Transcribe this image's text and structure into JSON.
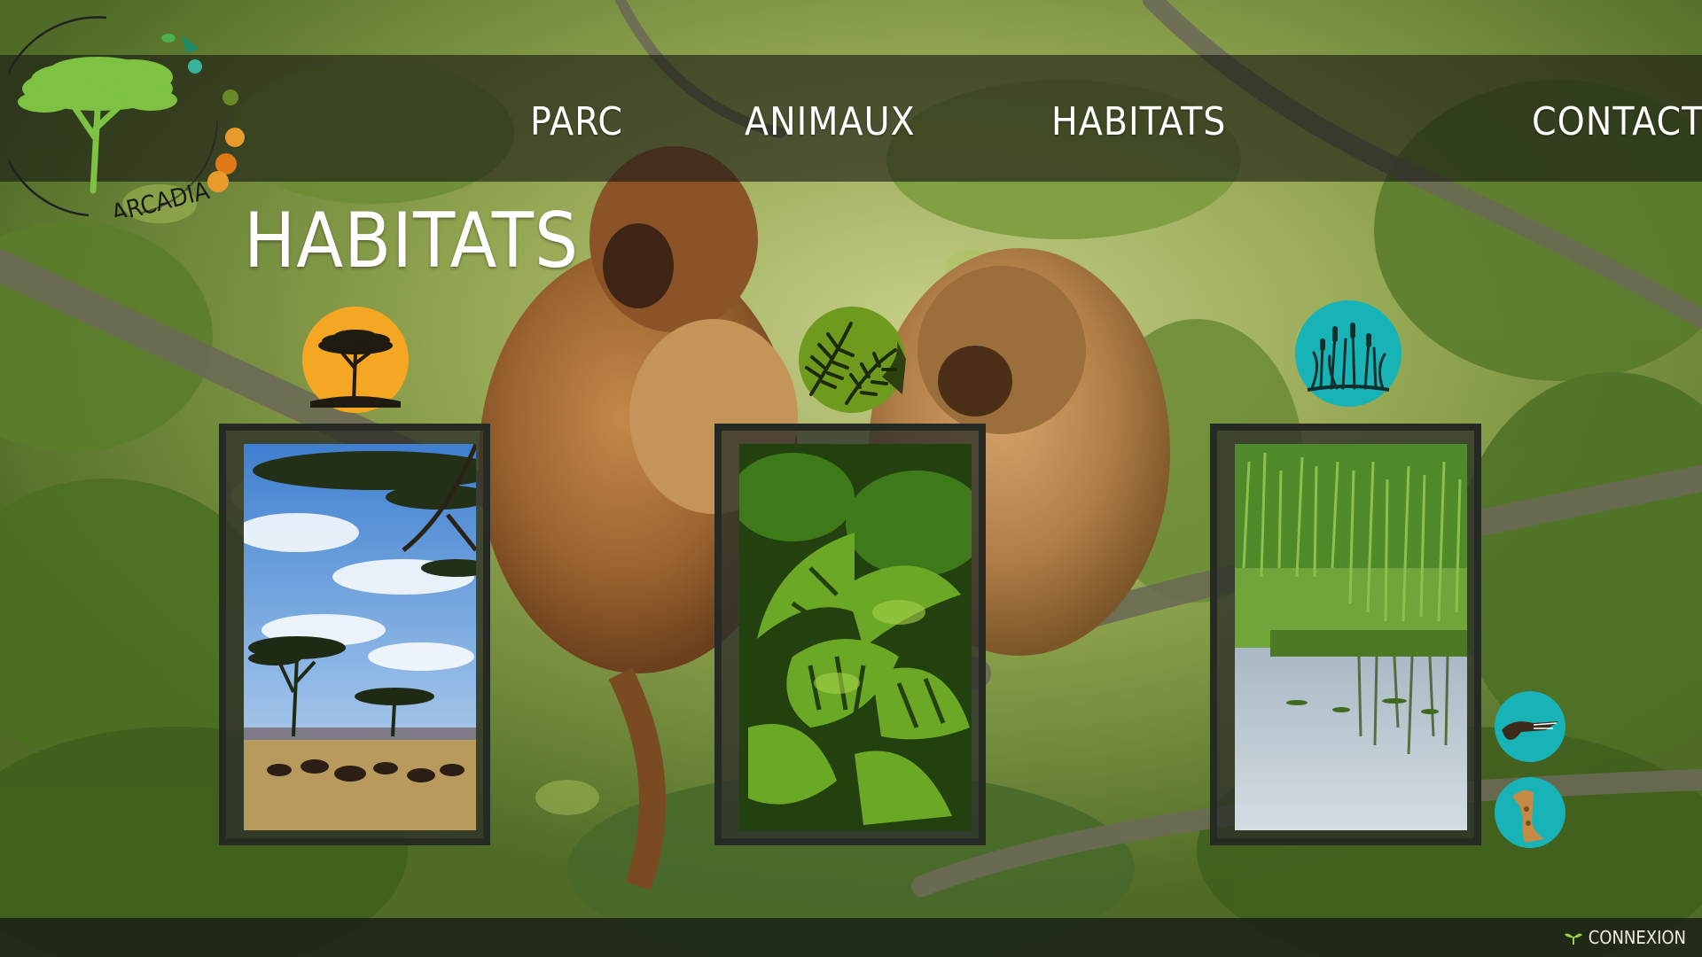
{
  "brand": {
    "logo_text": "ARCADIA"
  },
  "nav": {
    "items": [
      {
        "label": "PARC"
      },
      {
        "label": "ANIMAUX"
      },
      {
        "label": "HABITATS"
      },
      {
        "label": "CONTACT"
      }
    ]
  },
  "page": {
    "title": "HABITATS"
  },
  "habitats": [
    {
      "icon": "savanna-tree-icon",
      "color": "#f5a623"
    },
    {
      "icon": "jungle-fern-icon",
      "color": "#6e9a1e"
    },
    {
      "icon": "marsh-reeds-icon",
      "color": "#17b3b6"
    }
  ],
  "side_buttons": [
    {
      "icon": "crocodile-icon",
      "color": "#17b3b6"
    },
    {
      "icon": "giraffe-icon",
      "color": "#17b3b6"
    }
  ],
  "footer": {
    "login_label": "CONNEXION",
    "login_icon": "sprout-icon"
  },
  "colors": {
    "accent_orange": "#f5a623",
    "accent_green": "#6e9a1e",
    "accent_teal": "#17b3b6",
    "logo_green": "#7dc242",
    "paw_orange": "#e89a2a"
  }
}
